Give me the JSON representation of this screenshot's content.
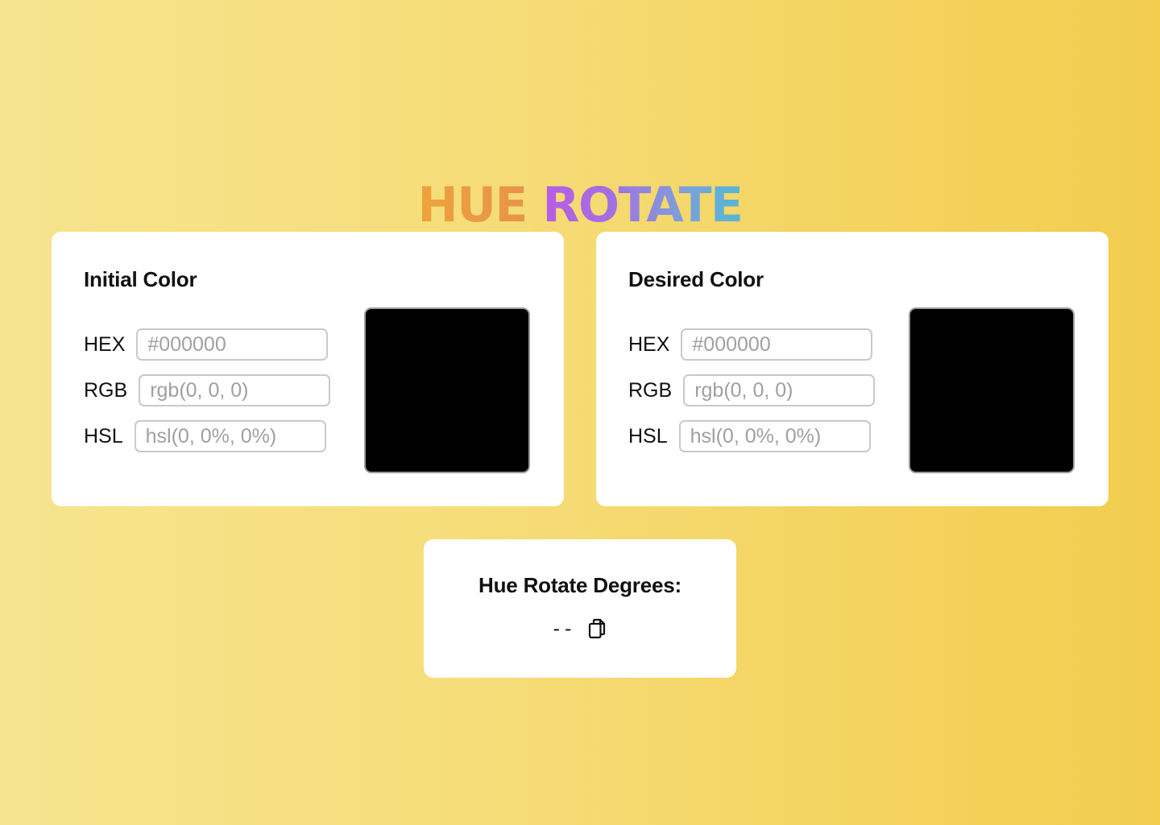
{
  "title": {
    "word1": "HUE",
    "word2": "ROTATE"
  },
  "initial": {
    "heading": "Initial Color",
    "hex_label": "HEX",
    "hex_placeholder": "#000000",
    "rgb_label": "RGB",
    "rgb_placeholder": "rgb(0, 0, 0)",
    "hsl_label": "HSL",
    "hsl_placeholder": "hsl(0, 0%, 0%)",
    "swatch_color": "#000000"
  },
  "desired": {
    "heading": "Desired Color",
    "hex_label": "HEX",
    "hex_placeholder": "#000000",
    "rgb_label": "RGB",
    "rgb_placeholder": "rgb(0, 0, 0)",
    "hsl_label": "HSL",
    "hsl_placeholder": "hsl(0, 0%, 0%)",
    "swatch_color": "#000000"
  },
  "result": {
    "heading": "Hue Rotate Degrees:",
    "value": "--",
    "copy_icon": "copy-icon"
  },
  "colors": {
    "title_hue": "#eea33a",
    "title_rotate_start": "#b85ce6",
    "title_rotate_end": "#53b8d4"
  }
}
